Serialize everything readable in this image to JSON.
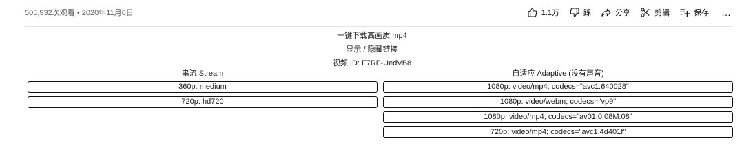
{
  "video": {
    "meta": "505,932次观看 • 2020年11月6日"
  },
  "actions": {
    "like_count": "1.1万",
    "dislike_label": "踩",
    "share_label": "分享",
    "clip_label": "剪辑",
    "save_label": "保存",
    "more_label": "…"
  },
  "downloader": {
    "title": "一键下载高画质 mp4",
    "toggle_label": "显示 / 隐藏链接",
    "video_id": "视频 ID: F7RF-UedVB8",
    "stream_header": "串流 Stream",
    "adaptive_header": "自适应 Adaptive (没有声音)",
    "streams": [
      {
        "label": "360p: medium"
      },
      {
        "label": "720p: hd720"
      }
    ],
    "adaptive": [
      {
        "label": "1080p: video/mp4; codecs=\"avc1.640028\""
      },
      {
        "label": "1080p: video/webm; codecs=\"vp9\""
      },
      {
        "label": "1080p: video/mp4; codecs=\"av01.0.08M.08\""
      },
      {
        "label": "720p: video/mp4; codecs=\"avc1.4d401f\""
      }
    ]
  },
  "colors": {
    "meta_text": "#606060",
    "divider": "#e5e5e5",
    "button_border": "#111111"
  },
  "icons": [
    "thumb-up-icon",
    "thumb-down-icon",
    "share-arrow-icon",
    "scissors-icon",
    "playlist-add-icon"
  ]
}
